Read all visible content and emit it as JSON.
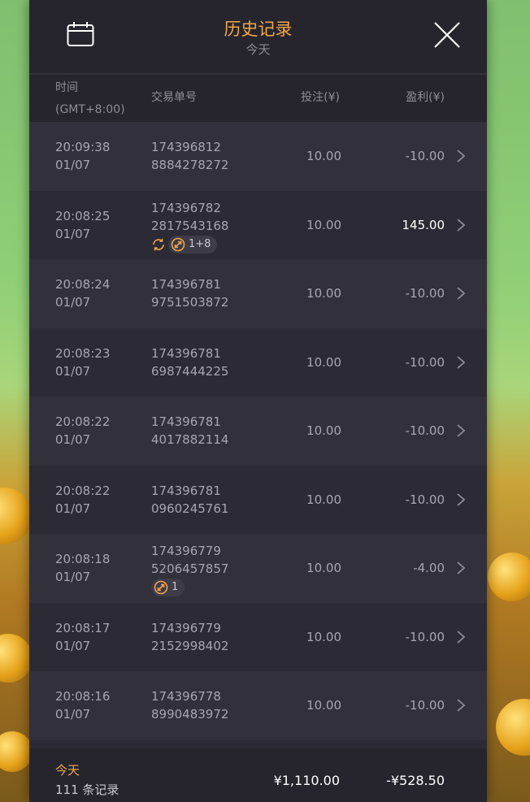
{
  "header": {
    "title": "历史记录",
    "subtitle": "今天"
  },
  "columns": {
    "time_line1": "时间",
    "time_line2": "(GMT+8:00)",
    "order": "交易单号",
    "bet": "投注(¥)",
    "profit": "盈利(¥)"
  },
  "rows": [
    {
      "time": "20:09:38",
      "date": "01/07",
      "order1": "174396812",
      "order2": "8884278272",
      "bet": "10.00",
      "profit": "-10.00"
    },
    {
      "time": "20:08:25",
      "date": "01/07",
      "order1": "174396782",
      "order2": "2817543168",
      "bet": "10.00",
      "profit": "145.00",
      "badge": "1+8",
      "refresh": true
    },
    {
      "time": "20:08:24",
      "date": "01/07",
      "order1": "174396781",
      "order2": "9751503872",
      "bet": "10.00",
      "profit": "-10.00"
    },
    {
      "time": "20:08:23",
      "date": "01/07",
      "order1": "174396781",
      "order2": "6987444225",
      "bet": "10.00",
      "profit": "-10.00"
    },
    {
      "time": "20:08:22",
      "date": "01/07",
      "order1": "174396781",
      "order2": "4017882114",
      "bet": "10.00",
      "profit": "-10.00"
    },
    {
      "time": "20:08:22",
      "date": "01/07",
      "order1": "174396781",
      "order2": "0960245761",
      "bet": "10.00",
      "profit": "-10.00"
    },
    {
      "time": "20:08:18",
      "date": "01/07",
      "order1": "174396779",
      "order2": "5206457857",
      "bet": "10.00",
      "profit": "-4.00",
      "badge": "1"
    },
    {
      "time": "20:08:17",
      "date": "01/07",
      "order1": "174396779",
      "order2": "2152998402",
      "bet": "10.00",
      "profit": "-10.00"
    },
    {
      "time": "20:08:16",
      "date": "01/07",
      "order1": "174396778",
      "order2": "8990483972",
      "bet": "10.00",
      "profit": "-10.00"
    }
  ],
  "footer": {
    "label": "今天",
    "count": "111 条记录",
    "total_bet": "¥1,110.00",
    "total_profit": "-¥528.50"
  },
  "colors": {
    "accent": "#f0a64a",
    "panel": "#2c2b35",
    "row_alt": "#32313b"
  }
}
